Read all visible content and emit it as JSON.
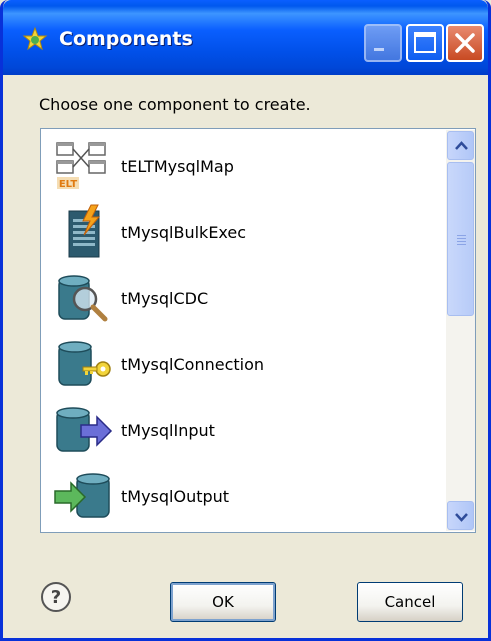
{
  "window": {
    "title": "Components",
    "title_icon": "puzzle-star-icon"
  },
  "prompt": "Choose one component to create.",
  "components": [
    {
      "label": "tELTMysqlMap",
      "icon": "elt-map-icon"
    },
    {
      "label": "tMysqlBulkExec",
      "icon": "bulk-exec-icon"
    },
    {
      "label": "tMysqlCDC",
      "icon": "cdc-magnifier-icon"
    },
    {
      "label": "tMysqlConnection",
      "icon": "connection-key-icon"
    },
    {
      "label": "tMysqlInput",
      "icon": "input-arrow-icon"
    },
    {
      "label": "tMysqlOutput",
      "icon": "output-arrow-icon"
    }
  ],
  "elt_badge": "ELT",
  "buttons": {
    "ok": "OK",
    "cancel": "Cancel",
    "help": "?"
  },
  "colors": {
    "titlebar": "#0A5FFF",
    "dialog_bg": "#ECE9D8",
    "close_button": "#C84A22"
  }
}
